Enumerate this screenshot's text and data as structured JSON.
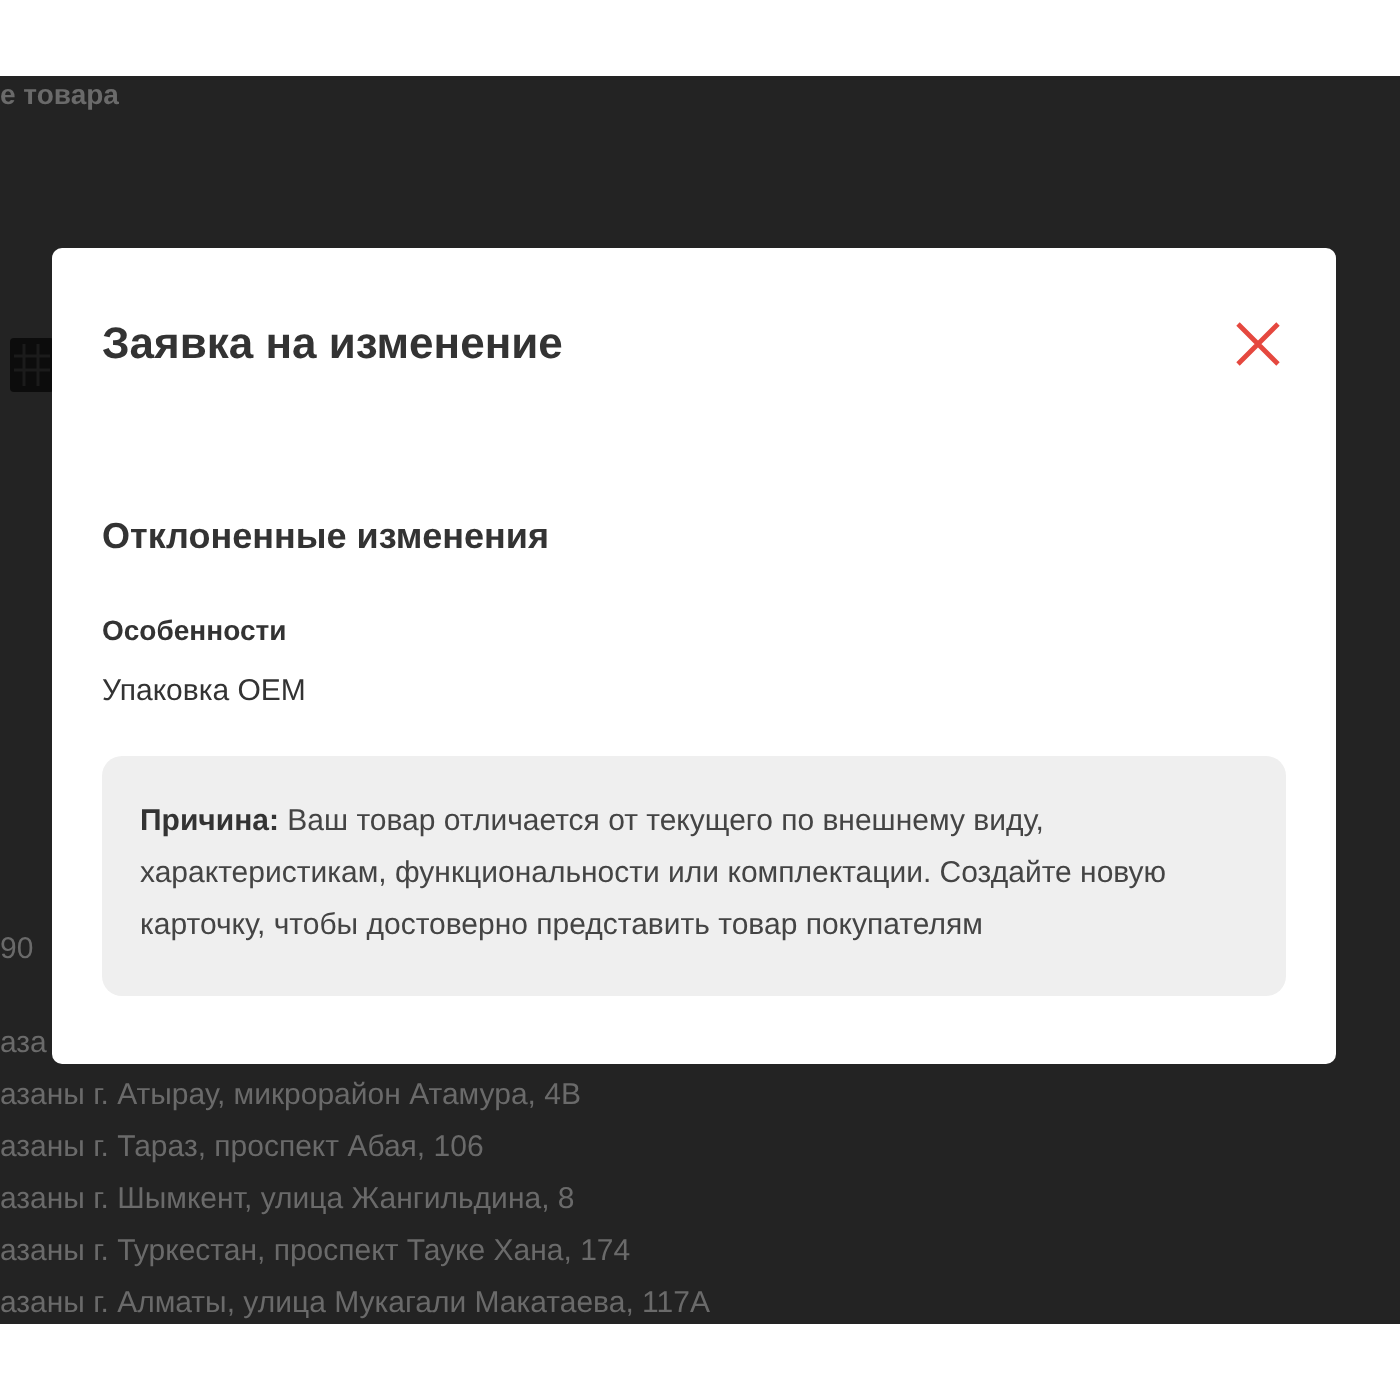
{
  "background_page": {
    "heading": "е товара",
    "price": "90",
    "addresses": [
      "аза",
      "азаны г. Атырау, микрорайон Атамура, 4В",
      "азаны г. Тараз, проспект Абая, 106",
      "азаны г. Шымкент, улица Жангильдина, 8",
      "азаны г. Туркестан, проспект Тауке Хана, 174",
      "азаны г. Алматы, улица Мукагали Макатаева, 117А"
    ]
  },
  "modal": {
    "title": "Заявка на изменение",
    "section_title": "Отклоненные изменения",
    "field_label": "Особенности",
    "field_value": "Упаковка OEM",
    "reason": "**Причина:** Ваш товар отличается от текущего по внешнему виду, характеристикам, функциональности или комплектации. Создайте новую карточку, чтобы достоверно представить товар покупателям"
  }
}
